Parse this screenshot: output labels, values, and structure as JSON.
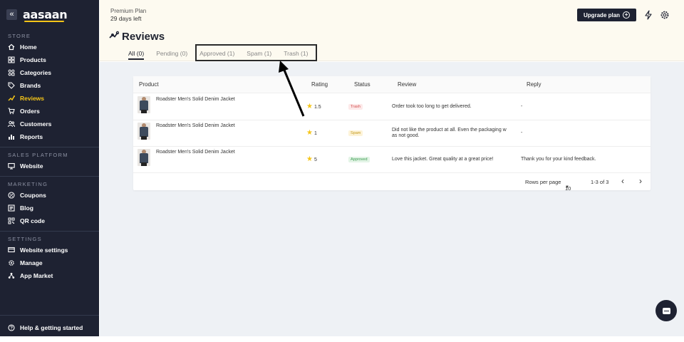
{
  "brand": {
    "logo": "aasaan",
    "collapse_glyph": "«"
  },
  "sidebar": {
    "store_title": "STORE",
    "store_items": [
      {
        "label": "Home",
        "icon": "home-icon"
      },
      {
        "label": "Products",
        "icon": "grid-icon"
      },
      {
        "label": "Categories",
        "icon": "categories-icon"
      },
      {
        "label": "Brands",
        "icon": "tag-icon"
      },
      {
        "label": "Reviews",
        "icon": "reviews-icon",
        "active": true
      },
      {
        "label": "Orders",
        "icon": "cart-icon"
      },
      {
        "label": "Customers",
        "icon": "users-icon"
      },
      {
        "label": "Reports",
        "icon": "bar-chart-icon"
      }
    ],
    "sales_title": "SALES PLATFORM",
    "sales_items": [
      {
        "label": "Website",
        "icon": "monitor-icon"
      }
    ],
    "marketing_title": "MARKETING",
    "marketing_items": [
      {
        "label": "Coupons",
        "icon": "coupon-icon"
      },
      {
        "label": "Blog",
        "icon": "blog-icon"
      },
      {
        "label": "QR code",
        "icon": "qr-icon"
      }
    ],
    "settings_title": "SETTINGS",
    "settings_items": [
      {
        "label": "Website settings",
        "icon": "website-settings-icon"
      },
      {
        "label": "Manage",
        "icon": "gear-icon"
      },
      {
        "label": "App Market",
        "icon": "app-market-icon"
      }
    ],
    "help_label": "Help & getting started"
  },
  "header": {
    "plan": "Premium Plan",
    "days_left": "29 days left",
    "upgrade_label": "Upgrade plan",
    "page_title": "Reviews"
  },
  "tabs": [
    {
      "label": "All (0)",
      "active": true
    },
    {
      "label": "Pending (0)"
    },
    {
      "label": "Approved (1)"
    },
    {
      "label": "Spam (1)"
    },
    {
      "label": "Trash (1)"
    }
  ],
  "table": {
    "headers": {
      "product": "Product",
      "rating": "Rating",
      "status": "Status",
      "review": "Review",
      "reply": "Reply"
    },
    "rows": [
      {
        "product": "Roadster Men's Solid Denim Jacket",
        "rating": "1.5",
        "status": "Trash",
        "review_line1": "Order took too long to get delivered.",
        "review_line2": "",
        "reply": "-"
      },
      {
        "product": "Roadster Men's Solid Denim Jacket",
        "rating": "1",
        "status": "Spam",
        "review_line1": "Did not like the product at all. Even the packaging w",
        "review_line2": "as not good.",
        "reply": "-"
      },
      {
        "product": "Roadster Men's Solid Denim Jacket",
        "rating": "5",
        "status": "Approved",
        "review_line1": "Love this jacket. Great quality at a great price!",
        "review_line2": "",
        "reply": "Thank you for your kind feedback."
      }
    ]
  },
  "pager": {
    "rows_label": "Rows per page",
    "rows_value": "10",
    "range": "1-3 of 3",
    "prev": "‹",
    "next": "›"
  },
  "colors": {
    "sidebar_bg": "#1e2232",
    "accent": "#f5c518",
    "header_bg": "#fdfaf0",
    "content_bg": "#eef1f5"
  }
}
